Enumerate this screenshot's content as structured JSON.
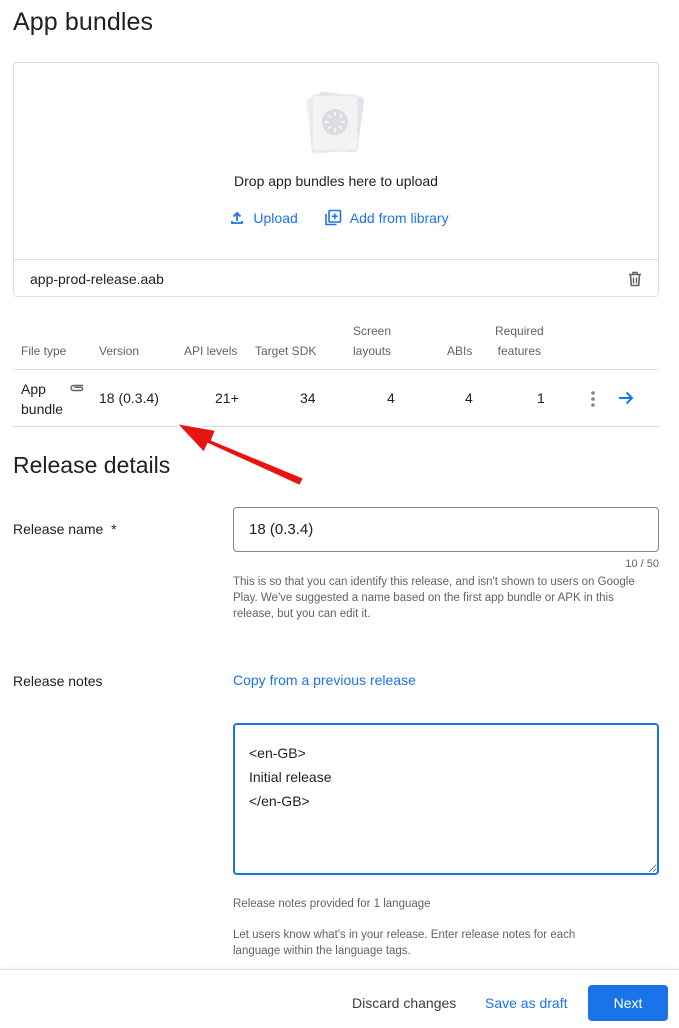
{
  "page": {
    "title": "App bundles"
  },
  "upload": {
    "drop_text": "Drop app bundles here to upload",
    "upload_label": "Upload",
    "library_label": "Add from library",
    "file_name": "app-prod-release.aab"
  },
  "table": {
    "headers": {
      "file_type": "File type",
      "version": "Version",
      "api_levels": "API levels",
      "target_sdk": "Target SDK",
      "screen_layouts_1": "Screen",
      "screen_layouts_2": "layouts",
      "abis": "ABIs",
      "required_features_1": "Required",
      "required_features_2": "features"
    },
    "row": {
      "file_type_1": "App",
      "file_type_2": "bundle",
      "version": "18 (0.3.4)",
      "api_levels": "21+",
      "target_sdk": "34",
      "screen_layouts": "4",
      "abis": "4",
      "required_features": "1"
    }
  },
  "release": {
    "section_title": "Release details",
    "name_label": "Release name",
    "required_mark": "*",
    "name_value": "18 (0.3.4)",
    "counter": "10 / 50",
    "name_helper": "This is so that you can identify this release, and isn't shown to users on Google Play. We've suggested a name based on the first app bundle or APK in this release, but you can edit it.",
    "notes_label": "Release notes",
    "copy_link": "Copy from a previous release",
    "notes_value": "<en-GB>\nInitial release\n</en-GB>",
    "notes_helper_1": "Release notes provided for 1 language",
    "notes_helper_2": "Let users know what's in your release. Enter release notes for each language within the language tags."
  },
  "footer": {
    "discard_label": "Discard changes",
    "draft_label": "Save as draft",
    "next_label": "Next"
  },
  "colors": {
    "accent": "#1a73e8",
    "annotation_arrow": "#e8140f"
  }
}
